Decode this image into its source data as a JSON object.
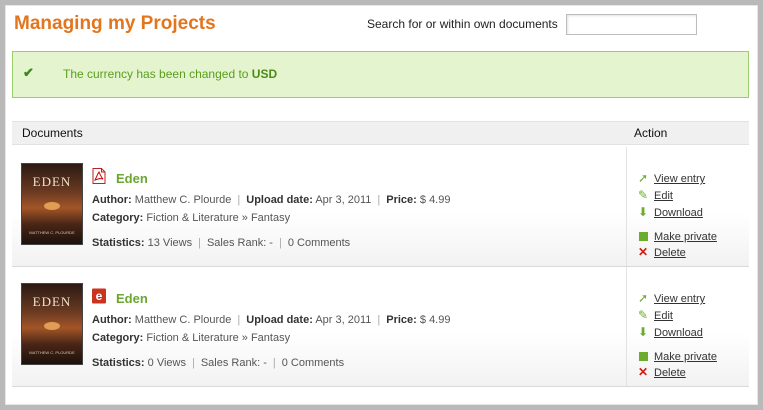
{
  "header": {
    "title": "Managing my Projects",
    "search_label": "Search for or within own documents",
    "search_value": ""
  },
  "notice": {
    "text": "The currency has been changed to ",
    "currency": "USD",
    "icon": "checkmark-icon"
  },
  "table": {
    "col_documents": "Documents",
    "col_action": "Action"
  },
  "labels": {
    "author": "Author:",
    "upload_date": "Upload date:",
    "price": "Price:",
    "category": "Category:",
    "statistics": "Statistics:",
    "sales_rank": "Sales Rank: -"
  },
  "rows": [
    {
      "cover_title": "EDEN",
      "cover_author": "MATTHEW C. PLOURDE",
      "file_icon": "pdf-icon",
      "title": "Eden",
      "author": "Matthew C. Plourde",
      "upload_date": "Apr 3, 2011",
      "price": "$ 4.99",
      "category": "Fiction & Literature » Fantasy",
      "views": "13 Views",
      "comments": "0 Comments"
    },
    {
      "cover_title": "EDEN",
      "cover_author": "MATTHEW C. PLOURDE",
      "file_icon": "epub-icon",
      "title": "Eden",
      "author": "Matthew C. Plourde",
      "upload_date": "Apr 3, 2011",
      "price": "$ 4.99",
      "category": "Fiction & Literature » Fantasy",
      "views": "0 Views",
      "comments": "0 Comments"
    }
  ],
  "actions": {
    "view": "View entry",
    "edit": "Edit",
    "download": "Download",
    "make_private": "Make private",
    "delete": "Delete"
  },
  "colors": {
    "title_orange": "#e2761f",
    "accent_green": "#6ba630",
    "notice_bg": "#e4f4cf",
    "delete_red": "#d21c10"
  }
}
